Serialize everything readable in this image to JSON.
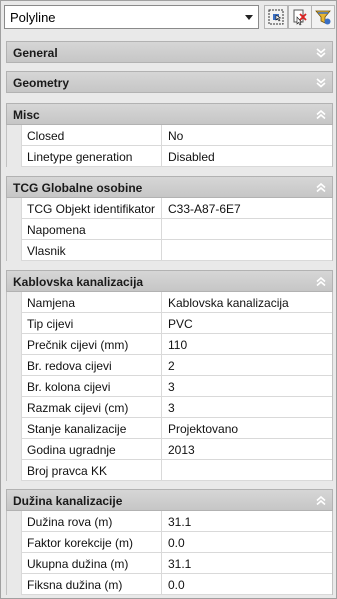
{
  "toolbar": {
    "object_type": "Polyline",
    "icons": [
      "select-objects-icon",
      "quick-select-icon",
      "filter-icon"
    ]
  },
  "sections": {
    "general": {
      "title": "General",
      "state": "collapsed"
    },
    "geometry": {
      "title": "Geometry",
      "state": "collapsed"
    },
    "misc": {
      "title": "Misc",
      "state": "expanded",
      "rows": [
        {
          "key": "Closed",
          "value": "No"
        },
        {
          "key": "Linetype generation",
          "value": "Disabled"
        }
      ]
    },
    "tcg": {
      "title": "TCG Globalne osobine",
      "state": "expanded",
      "rows": [
        {
          "key": "TCG Objekt identifikator",
          "value": "C33-A87-6E7"
        },
        {
          "key": "Napomena",
          "value": ""
        },
        {
          "key": "Vlasnik",
          "value": ""
        }
      ]
    },
    "kablovska": {
      "title": "Kablovska kanalizacija",
      "state": "expanded",
      "rows": [
        {
          "key": "Namjena",
          "value": "Kablovska kanalizacija"
        },
        {
          "key": "Tip cijevi",
          "value": "PVC"
        },
        {
          "key": "Prečnik cijevi (mm)",
          "value": "110"
        },
        {
          "key": "Br. redova cijevi",
          "value": "2"
        },
        {
          "key": "Br. kolona cijevi",
          "value": "3"
        },
        {
          "key": "Razmak cijevi (cm)",
          "value": "3"
        },
        {
          "key": "Stanje kanalizacije",
          "value": "Projektovano"
        },
        {
          "key": "Godina ugradnje",
          "value": "2013"
        },
        {
          "key": "Broj pravca KK",
          "value": ""
        }
      ]
    },
    "duzina": {
      "title": "Dužina kanalizacije",
      "state": "expanded",
      "rows": [
        {
          "key": "Dužina rova (m)",
          "value": "31.1"
        },
        {
          "key": "Faktor korekcije (m)",
          "value": "0.0"
        },
        {
          "key": "Ukupna dužina (m)",
          "value": "31.1"
        },
        {
          "key": "Fiksna dužina (m)",
          "value": "0.0"
        }
      ]
    }
  }
}
